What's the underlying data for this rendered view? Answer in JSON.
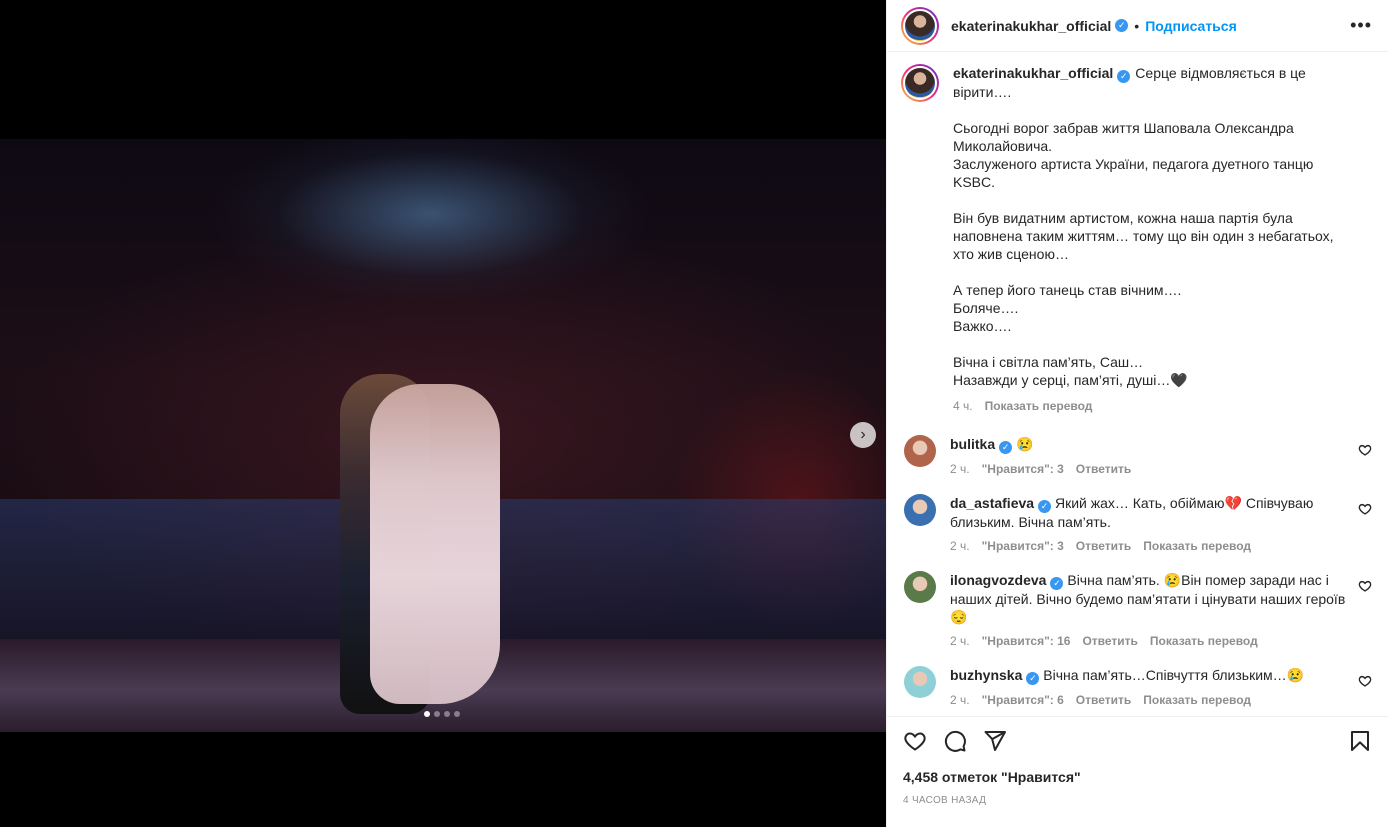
{
  "post": {
    "username": "ekaterinakukhar_official",
    "follow_label": "Подписаться",
    "bullet": "•",
    "caption_lines": [
      "Серце відмовляється в це вірити….",
      "",
      "Сьогодні ворог забрав життя Шаповала Олександра Миколайовича.",
      "Заслуженого артиста України, педагога дуетного танцю KSBC.",
      "",
      "Він був видатним артистом, кожна наша партія була наповнена таким життям… тому що він один з небагатьох, хто жив сценою…",
      "",
      "А тепер його танець став вічним….",
      "Боляче….",
      "Важко….",
      "",
      "Вічна і світла пам’ять, Саш…",
      "Назавжди у серці, пам’яті, душі…🖤"
    ],
    "caption_time": "4 ч.",
    "translate_label": "Показать перевод",
    "likes": "4,458 отметок \"Нравится\"",
    "time_ago": "4 ЧАСОВ НАЗАД",
    "carousel": {
      "total": 4,
      "active": 1
    }
  },
  "comments": [
    {
      "user": "bulitka",
      "text": "😢",
      "time": "2 ч.",
      "likes": "\"Нравится\": 3",
      "reply": "Ответить",
      "translate": "",
      "avatar_color": "#b0644a"
    },
    {
      "user": "da_astafieva",
      "text": "Який жах… Кать, обіймаю💔 Співчуваю близьким. Вічна пам’ять.",
      "time": "2 ч.",
      "likes": "\"Нравится\": 3",
      "reply": "Ответить",
      "translate": "Показать перевод",
      "avatar_color": "#3a6fb0"
    },
    {
      "user": "ilonagvozdeva",
      "text": "Вічна пам’ять. 😢Він помер заради нас і наших дітей. Вічно будемо пам’ятати і цінувати наших героїв 😔",
      "time": "2 ч.",
      "likes": "\"Нравится\": 16",
      "reply": "Ответить",
      "translate": "Показать перевод",
      "avatar_color": "#5a7a4a"
    },
    {
      "user": "buzhynska",
      "text": "Вічна пам’ять…Співчуття близьким…😢",
      "time": "2 ч.",
      "likes": "\"Нравится\": 6",
      "reply": "Ответить",
      "translate": "Показать перевод",
      "avatar_color": "#8fcfd8"
    }
  ],
  "icons": {
    "like": "heart-icon",
    "comment": "comment-icon",
    "share": "share-icon",
    "save": "bookmark-icon",
    "more": "more-icon",
    "next": "chevron-right-icon",
    "verified": "verified-badge-icon"
  },
  "colors": {
    "accent": "#0095f6",
    "verified": "#3897f0",
    "muted": "#8e8e8e"
  }
}
